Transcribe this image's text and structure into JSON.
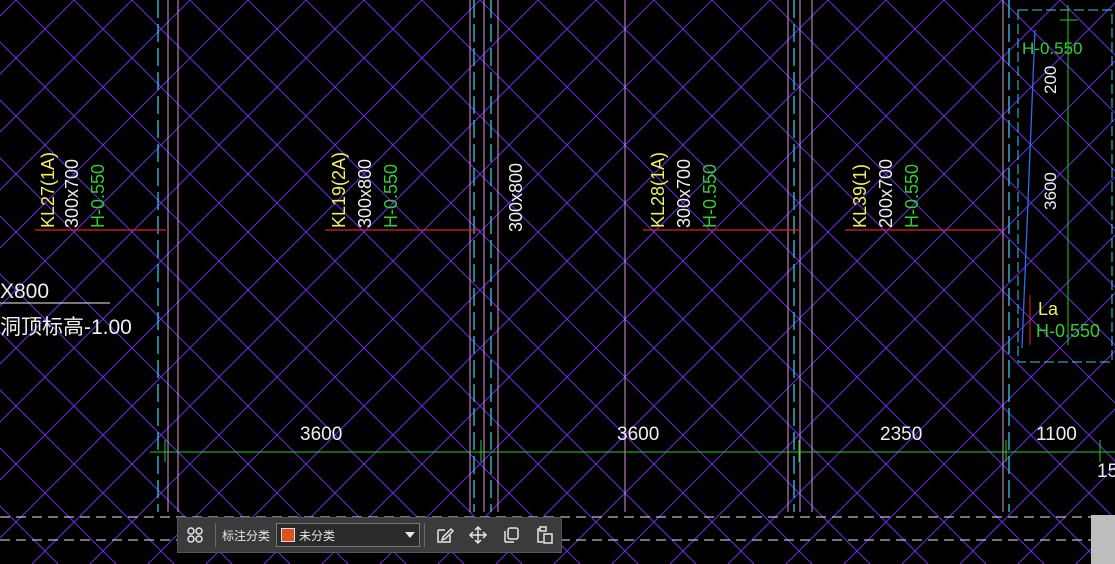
{
  "drawing": {
    "beam_labels": [
      {
        "name": "KL27(1A)",
        "size": "300x700",
        "elev": "H-0.550"
      },
      {
        "name": "KL19(2A)",
        "size": "300x800",
        "elev": "H-0.550"
      },
      {
        "name": "",
        "size": "300x800",
        "elev": ""
      },
      {
        "name": "KL28(1A)",
        "size": "300x700",
        "elev": "H-0.550"
      },
      {
        "name": "KL39(1)",
        "size": "200x700",
        "elev": "H-0.550"
      }
    ],
    "left_note": {
      "size": "X800",
      "text": "洞顶标高-1.00"
    },
    "right_detail": {
      "top_elev": "H-0.550",
      "dim_200": "200",
      "dim_3600": "3600",
      "la": "La",
      "bottom_elev": "H-0.550"
    },
    "dimensions": [
      "3600",
      "3600",
      "2350",
      "1100"
    ],
    "edge_text": "15"
  },
  "toolbar": {
    "label": "标注分类",
    "select_value": "未分类",
    "swatch_color": "#e0521c",
    "icons": [
      "grid-icon",
      "edit-icon",
      "move-icon",
      "copy-icon",
      "paste-icon"
    ]
  },
  "colors": {
    "hatch": "#6a2ee0",
    "grid_green": "#22cc22",
    "axis_cyan": "#37c8e6",
    "beam_red": "#e02020",
    "text_yellow": "#f0f060",
    "text_white": "#f0f0f0",
    "text_green": "#30d030",
    "pink": "#d39ad6"
  }
}
